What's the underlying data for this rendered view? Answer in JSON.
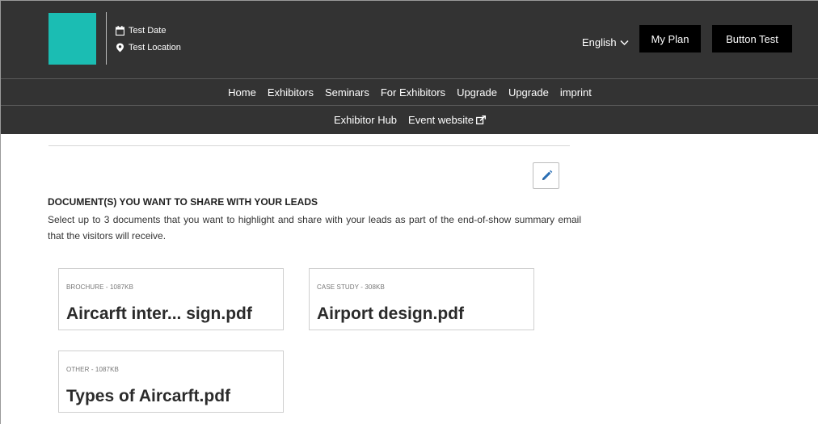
{
  "header": {
    "date_label": "Test Date",
    "location_label": "Test Location",
    "language": "English",
    "my_plan_label": "My Plan",
    "button_test_label": "Button Test",
    "logo_color": "#1bbdb3"
  },
  "nav": {
    "primary": [
      "Home",
      "Exhibitors",
      "Seminars",
      "For Exhibitors",
      "Upgrade",
      "Upgrade",
      "imprint"
    ],
    "secondary": [
      "Exhibitor Hub",
      "Event website"
    ]
  },
  "documents": {
    "title": "DOCUMENT(S) YOU WANT TO SHARE WITH YOUR LEADS",
    "description": "Select up to 3 documents that you want to highlight and share with your leads as part of the end-of-show summary email that the visitors will receive.",
    "items": [
      {
        "type": "BROCHURE",
        "size": "1087KB",
        "meta": "BROCHURE - 1087KB",
        "name": "Aircarft inter... sign.pdf"
      },
      {
        "type": "CASE STUDY",
        "size": "308KB",
        "meta": "CASE STUDY - 308KB",
        "name": "Airport design.pdf"
      },
      {
        "type": "OTHER",
        "size": "1087KB",
        "meta": "OTHER - 1087KB",
        "name": "Types of Aircarft.pdf"
      }
    ]
  },
  "icons": {
    "calendar": "calendar-icon",
    "location": "location-pin-icon",
    "chevron": "chevron-down-icon",
    "external": "external-link-icon",
    "edit": "pencil-icon"
  },
  "colors": {
    "header_bg": "#333333",
    "button_bg": "#000000",
    "accent": "#1bbdb3",
    "edit_icon": "#2a6fb5"
  }
}
